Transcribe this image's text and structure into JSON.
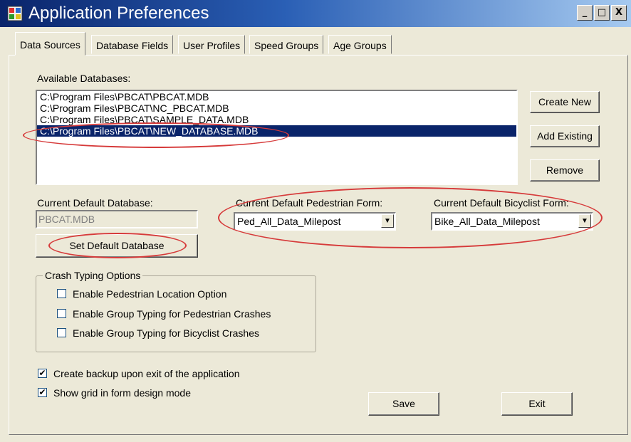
{
  "window": {
    "title": "Application Preferences",
    "controls": {
      "minimize": "_",
      "maximize": "□",
      "close": "X"
    }
  },
  "tabs": [
    {
      "label": "Data Sources",
      "active": true
    },
    {
      "label": "Database Fields",
      "active": false
    },
    {
      "label": "User Profiles",
      "active": false
    },
    {
      "label": "Speed Groups",
      "active": false
    },
    {
      "label": "Age Groups",
      "active": false
    }
  ],
  "data_sources": {
    "available_label": "Available Databases:",
    "databases": [
      "C:\\Program Files\\PBCAT\\PBCAT.MDB",
      "C:\\Program Files\\PBCAT\\NC_PBCAT.MDB",
      "C:\\Program Files\\PBCAT\\SAMPLE_DATA.MDB",
      "C:\\Program Files\\PBCAT\\NEW_DATABASE.MDB"
    ],
    "selected_index": 3,
    "buttons": {
      "create_new": "Create New",
      "add_existing": "Add Existing",
      "remove": "Remove"
    },
    "current_default_label": "Current Default Database:",
    "current_default_value": "PBCAT.MDB",
    "set_default_button": "Set Default Database",
    "pedestrian_form_label": "Current Default Pedestrian Form:",
    "pedestrian_form_value": "Ped_All_Data_Milepost",
    "bicyclist_form_label": "Current Default Bicyclist Form:",
    "bicyclist_form_value": "Bike_All_Data_Milepost"
  },
  "crash_typing": {
    "title": "Crash Typing Options",
    "options": [
      {
        "label": "Enable Pedestrian Location Option",
        "checked": false
      },
      {
        "label": "Enable Group Typing for Pedestrian Crashes",
        "checked": false
      },
      {
        "label": "Enable Group Typing for Bicyclist Crashes",
        "checked": false
      }
    ]
  },
  "general_options": [
    {
      "label": "Create backup upon exit of the application",
      "checked": true
    },
    {
      "label": "Show grid in form design mode",
      "checked": true
    }
  ],
  "footer": {
    "save_button": "Save",
    "exit_button": "Exit"
  },
  "colors": {
    "annotation": "#d63a3a",
    "selection": "#0a246a",
    "title_bar": "#0a246a"
  }
}
